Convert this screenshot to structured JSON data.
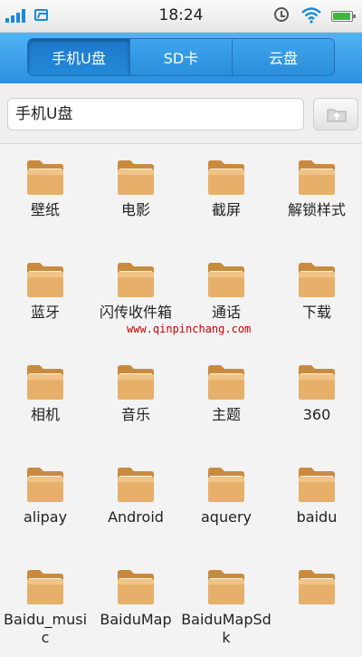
{
  "status_bar": {
    "time": "18:24",
    "icons": [
      "signal-icon",
      "image-icon",
      "alarm-icon",
      "wifi-icon",
      "battery-icon"
    ]
  },
  "tabs": [
    {
      "label": "手机U盘",
      "active": true
    },
    {
      "label": "SD卡",
      "active": false
    },
    {
      "label": "云盘",
      "active": false
    }
  ],
  "path_bar": {
    "path": "手机U盘",
    "up_button_icon": "upload-folder-icon"
  },
  "folders": [
    {
      "name": "壁纸"
    },
    {
      "name": "电影"
    },
    {
      "name": "截屏"
    },
    {
      "name": "解锁样式"
    },
    {
      "name": "蓝牙"
    },
    {
      "name": "闪传收件箱"
    },
    {
      "name": "通话"
    },
    {
      "name": "下载"
    },
    {
      "name": "相机"
    },
    {
      "name": "音乐"
    },
    {
      "name": "主题"
    },
    {
      "name": "360"
    },
    {
      "name": "alipay"
    },
    {
      "name": "Android"
    },
    {
      "name": "aquery"
    },
    {
      "name": "baidu"
    },
    {
      "name": "Baidu_music"
    },
    {
      "name": "BaiduMap"
    },
    {
      "name": "BaiduMapSdk"
    },
    {
      "name": ""
    }
  ],
  "watermark": "www.qinpinchang.com",
  "colors": {
    "header_blue": "#2a8fe0",
    "folder_tan": "#e6b06a",
    "watermark_red": "#cc0000"
  }
}
